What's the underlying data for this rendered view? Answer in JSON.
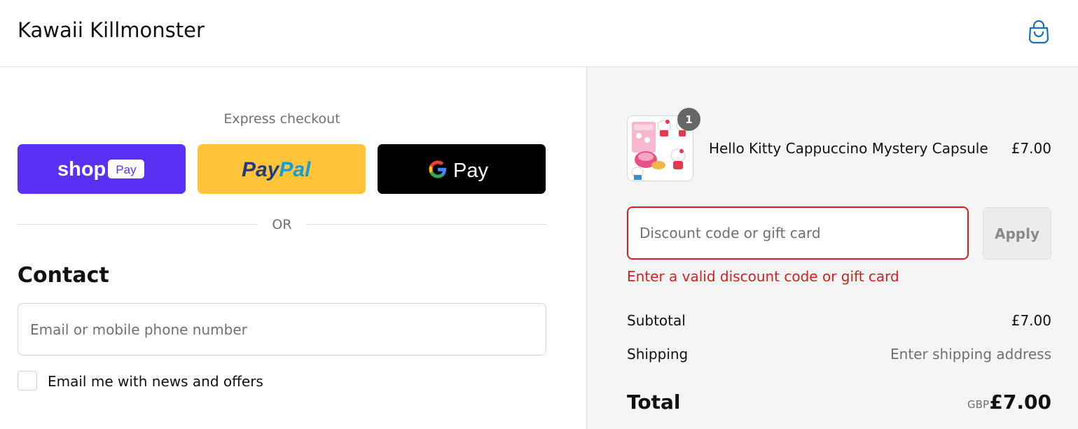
{
  "header": {
    "store_name": "Kawaii Killmonster",
    "cart_icon": "shopping-bag-icon",
    "accent_color": "#1773b0"
  },
  "express": {
    "label": "Express checkout",
    "shop_pay": {
      "word": "shop",
      "badge": "Pay",
      "color": "#5a31f4"
    },
    "paypal": {
      "part1": "Pay",
      "part2": "Pal",
      "color": "#ffc439"
    },
    "gpay": {
      "letter": "G",
      "word": "Pay",
      "color": "#000000"
    },
    "or_label": "OR"
  },
  "contact": {
    "title": "Contact",
    "email_placeholder": "Email or mobile phone number",
    "email_value": "",
    "newsletter_label": "Email me with news and offers",
    "newsletter_checked": false
  },
  "order": {
    "item": {
      "name": "Hello Kitty Cappuccino Mystery Capsule",
      "price": "£7.00",
      "quantity": "1"
    },
    "discount": {
      "placeholder": "Discount code or gift card",
      "value": "",
      "apply_label": "Apply",
      "error": "Enter a valid discount code or gift card",
      "error_color": "#dd1d1d"
    },
    "subtotal_label": "Subtotal",
    "subtotal_value": "£7.00",
    "shipping_label": "Shipping",
    "shipping_value": "Enter shipping address",
    "total_label": "Total",
    "total_currency": "GBP",
    "total_value": "£7.00"
  }
}
